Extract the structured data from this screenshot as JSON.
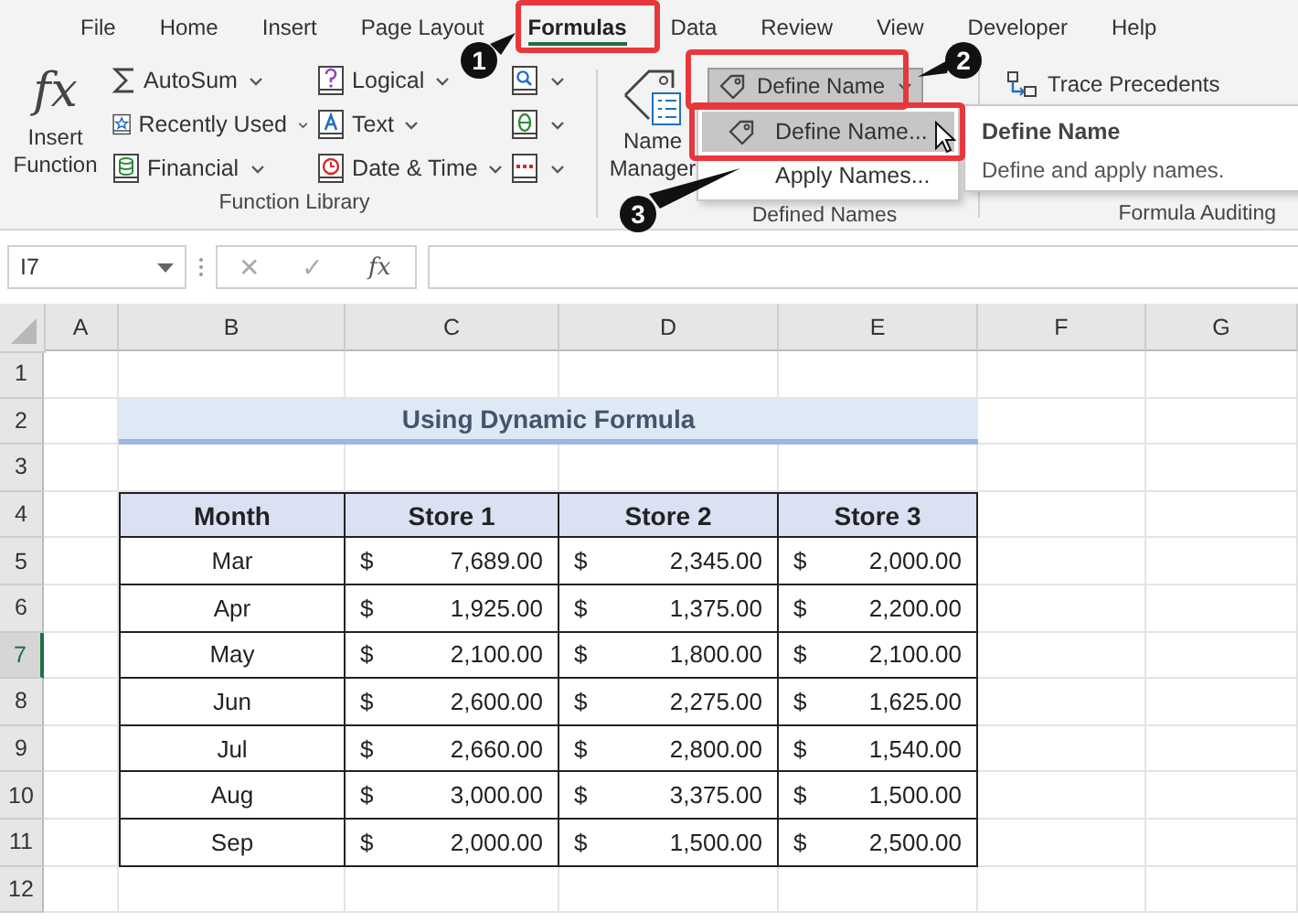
{
  "menu_tabs": [
    {
      "label": "File",
      "selected": false
    },
    {
      "label": "Home",
      "selected": false
    },
    {
      "label": "Insert",
      "selected": false
    },
    {
      "label": "Page Layout",
      "selected": false
    },
    {
      "label": "Formulas",
      "selected": true
    },
    {
      "label": "Data",
      "selected": false
    },
    {
      "label": "Review",
      "selected": false
    },
    {
      "label": "View",
      "selected": false
    },
    {
      "label": "Developer",
      "selected": false
    },
    {
      "label": "Help",
      "selected": false
    }
  ],
  "function_library": {
    "insert_function": {
      "glyph": "fx",
      "label": "Insert Function"
    },
    "commands": [
      {
        "kind": "sum",
        "label": "AutoSum"
      },
      {
        "kind": "recent",
        "label": "Recently Used"
      },
      {
        "kind": "financial",
        "label": "Financial"
      },
      {
        "kind": "logical",
        "label": "Logical"
      },
      {
        "kind": "text",
        "label": "Text"
      },
      {
        "kind": "date",
        "label": "Date & Time"
      },
      {
        "kind": "lookup"
      },
      {
        "kind": "math"
      },
      {
        "kind": "more"
      }
    ],
    "group_label": "Function Library"
  },
  "defined_names": {
    "name_manager": [
      "Name",
      "Manager"
    ],
    "define_name": {
      "label": "Define Name",
      "pressed": true
    },
    "group_label": "Defined Names"
  },
  "formula_auditing": {
    "trace_precedents": "Trace Precedents",
    "group_label": "Formula Auditing"
  },
  "dropdown_menu": [
    {
      "label": "Define Name...",
      "selected": true,
      "icon": true
    },
    {
      "label": "Apply Names...",
      "selected": false,
      "icon": false
    }
  ],
  "tooltip": {
    "title": "Define Name",
    "text": "Define and apply names."
  },
  "callouts": [
    {
      "number": "1"
    },
    {
      "number": "2"
    },
    {
      "number": "3"
    }
  ],
  "formula_bar": {
    "name_box": "I7",
    "cancel": "✕",
    "enter": "✓",
    "function": "fx"
  },
  "columns": [
    "A",
    "B",
    "C",
    "D",
    "E",
    "F",
    "G"
  ],
  "row_headers": [
    {
      "label": "1",
      "selected": false
    },
    {
      "label": "2",
      "selected": false
    },
    {
      "label": "3",
      "selected": false
    },
    {
      "label": "4",
      "selected": false
    },
    {
      "label": "5",
      "selected": false
    },
    {
      "label": "6",
      "selected": false
    },
    {
      "label": "7",
      "selected": true
    },
    {
      "label": "8",
      "selected": false
    },
    {
      "label": "9",
      "selected": false
    },
    {
      "label": "10",
      "selected": false
    },
    {
      "label": "11",
      "selected": false
    },
    {
      "label": "12",
      "selected": false
    }
  ],
  "sheet_title": "Using Dynamic Formula",
  "table": {
    "columns": [
      "Month",
      "Store 1",
      "Store 2",
      "Store 3"
    ],
    "rows": [
      {
        "month": "Mar",
        "values": [
          {
            "symbol": "$",
            "amount": "7,689.00"
          },
          {
            "symbol": "$",
            "amount": "2,345.00"
          },
          {
            "symbol": "$",
            "amount": "2,000.00"
          }
        ]
      },
      {
        "month": "Apr",
        "values": [
          {
            "symbol": "$",
            "amount": "1,925.00"
          },
          {
            "symbol": "$",
            "amount": "1,375.00"
          },
          {
            "symbol": "$",
            "amount": "2,200.00"
          }
        ]
      },
      {
        "month": "May",
        "values": [
          {
            "symbol": "$",
            "amount": "2,100.00"
          },
          {
            "symbol": "$",
            "amount": "1,800.00"
          },
          {
            "symbol": "$",
            "amount": "2,100.00"
          }
        ]
      },
      {
        "month": "Jun",
        "values": [
          {
            "symbol": "$",
            "amount": "2,600.00"
          },
          {
            "symbol": "$",
            "amount": "2,275.00"
          },
          {
            "symbol": "$",
            "amount": "1,625.00"
          }
        ]
      },
      {
        "month": "Jul",
        "values": [
          {
            "symbol": "$",
            "amount": "2,660.00"
          },
          {
            "symbol": "$",
            "amount": "2,800.00"
          },
          {
            "symbol": "$",
            "amount": "1,540.00"
          }
        ]
      },
      {
        "month": "Aug",
        "values": [
          {
            "symbol": "$",
            "amount": "3,000.00"
          },
          {
            "symbol": "$",
            "amount": "3,375.00"
          },
          {
            "symbol": "$",
            "amount": "1,500.00"
          }
        ]
      },
      {
        "month": "Sep",
        "values": [
          {
            "symbol": "$",
            "amount": "2,000.00"
          },
          {
            "symbol": "$",
            "amount": "1,500.00"
          },
          {
            "symbol": "$",
            "amount": "2,500.00"
          }
        ]
      }
    ]
  }
}
